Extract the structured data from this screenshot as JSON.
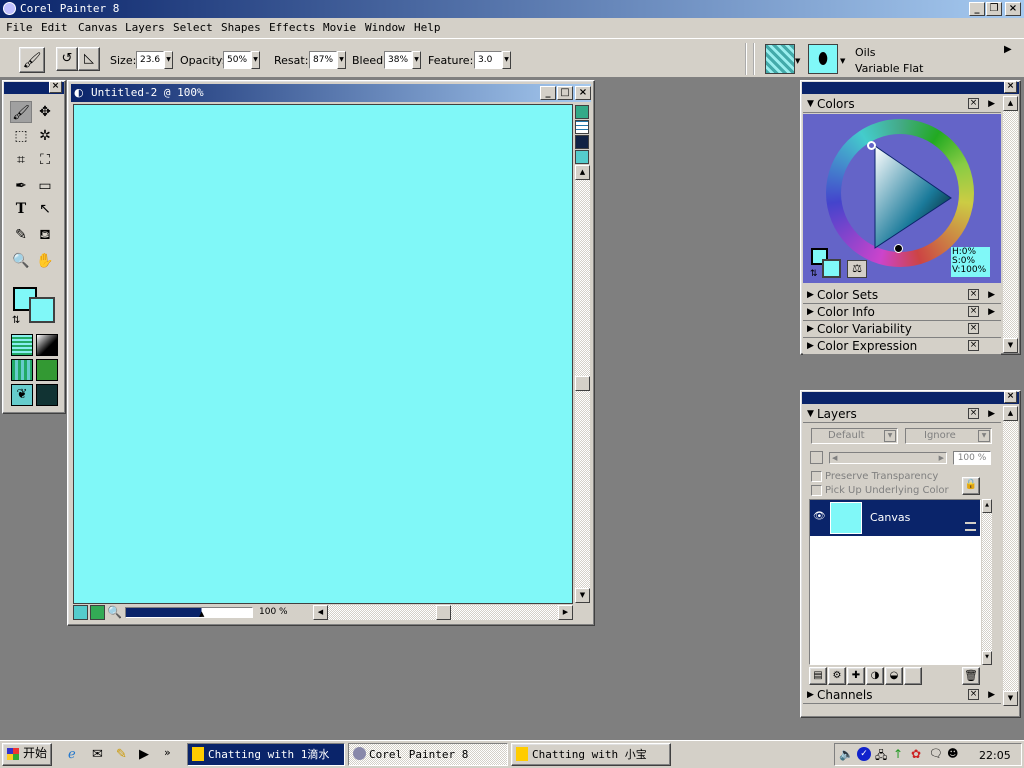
{
  "app": {
    "title": "Corel Painter 8"
  },
  "menu": [
    "File",
    "Edit",
    "Canvas",
    "Layers",
    "Select",
    "Shapes",
    "Effects",
    "Movie",
    "Window",
    "Help"
  ],
  "props": {
    "size_label": "Size:",
    "size_value": "23.6",
    "opacity_label": "Opacity:",
    "opacity_value": "50%",
    "resat_label": "Resat:",
    "resat_value": "87%",
    "bleed_label": "Bleed:",
    "bleed_value": "38%",
    "feature_label": "Feature:",
    "feature_value": "3.0"
  },
  "brush": {
    "category": "Oils",
    "variant": "Variable Flat"
  },
  "document": {
    "title": "Untitled-2 @ 100%",
    "zoom": "100 %",
    "canvas_color": "#80f8f8"
  },
  "colors_panel": {
    "title": "Colors",
    "h": "H:0%",
    "s": "S:0%",
    "v": "V:100%"
  },
  "collapsed_panels": [
    "Color Sets",
    "Color Info",
    "Color Variability",
    "Color Expression"
  ],
  "layers_panel": {
    "title": "Layers",
    "composite": "Default",
    "method": "Ignore",
    "opacity": "100 %",
    "preserve": "Preserve Transparency",
    "pickup": "Pick Up Underlying Color",
    "layer_name": "Canvas",
    "channels": "Channels"
  },
  "taskbar": {
    "start": "开始",
    "items": [
      "Chatting with  1滴水",
      "Corel Painter 8",
      "Chatting with  小宝"
    ],
    "clock": "22:05"
  },
  "colors": {
    "title_active": "#0a246a",
    "canvas": "#80f8f8",
    "face": "#d4d0c8",
    "layer_selected": "#0a246a"
  }
}
